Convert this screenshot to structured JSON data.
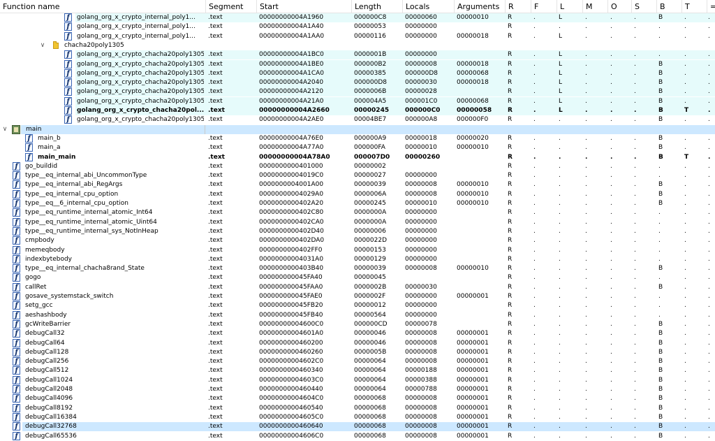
{
  "columns": [
    "Function name",
    "Segment",
    "Start",
    "Length",
    "Locals",
    "Arguments",
    "R",
    "F",
    "L",
    "M",
    "O",
    "S",
    "B",
    "T",
    "="
  ],
  "rows": [
    {
      "kind": "func",
      "level": 3,
      "hl": "cyan",
      "name": "golang_org_x_crypto_internal_poly1...",
      "seg": ".text",
      "start": "00000000004A1960",
      "len": "000000C8",
      "loc": "00000060",
      "args": "00000010",
      "R": "R",
      "F": ".",
      "L": "L",
      "M": ".",
      "O": ".",
      "S": ".",
      "B": "B",
      "T": ".",
      "E": "."
    },
    {
      "kind": "func",
      "level": 3,
      "name": "golang_org_x_crypto_internal_poly1...",
      "seg": ".text",
      "start": "00000000004A1A40",
      "len": "00000053",
      "loc": "00000000",
      "args": "",
      "R": "R",
      "F": ".",
      "L": ".",
      "M": ".",
      "O": ".",
      "S": ".",
      "B": ".",
      "T": ".",
      "E": "."
    },
    {
      "kind": "func",
      "level": 3,
      "name": "golang_org_x_crypto_internal_poly1...",
      "seg": ".text",
      "start": "00000000004A1AA0",
      "len": "00000116",
      "loc": "00000000",
      "args": "00000018",
      "R": "R",
      "F": ".",
      "L": "L",
      "M": ".",
      "O": ".",
      "S": ".",
      "B": ".",
      "T": ".",
      "E": "."
    },
    {
      "kind": "folder",
      "level": 2,
      "name": "chacha20poly1305"
    },
    {
      "kind": "func",
      "level": 3,
      "hl": "cyan",
      "name": "golang_org_x_crypto_chacha20poly1305...",
      "seg": ".text",
      "start": "00000000004A1BC0",
      "len": "0000001B",
      "loc": "00000000",
      "args": "",
      "R": "R",
      "F": ".",
      "L": "L",
      "M": ".",
      "O": ".",
      "S": ".",
      "B": ".",
      "T": ".",
      "E": "."
    },
    {
      "kind": "func",
      "level": 3,
      "hl": "cyan",
      "name": "golang_org_x_crypto_chacha20poly1305...",
      "seg": ".text",
      "start": "00000000004A1BE0",
      "len": "000000B2",
      "loc": "00000008",
      "args": "00000018",
      "R": "R",
      "F": ".",
      "L": "L",
      "M": ".",
      "O": ".",
      "S": ".",
      "B": "B",
      "T": ".",
      "E": "."
    },
    {
      "kind": "func",
      "level": 3,
      "hl": "cyan",
      "name": "golang_org_x_crypto_chacha20poly1305...",
      "seg": ".text",
      "start": "00000000004A1CA0",
      "len": "00000385",
      "loc": "000000D8",
      "args": "00000068",
      "R": "R",
      "F": ".",
      "L": "L",
      "M": ".",
      "O": ".",
      "S": ".",
      "B": "B",
      "T": ".",
      "E": "."
    },
    {
      "kind": "func",
      "level": 3,
      "hl": "cyan",
      "name": "golang_org_x_crypto_chacha20poly1305...",
      "seg": ".text",
      "start": "00000000004A2040",
      "len": "000000D8",
      "loc": "00000030",
      "args": "00000018",
      "R": "R",
      "F": ".",
      "L": "L",
      "M": ".",
      "O": ".",
      "S": ".",
      "B": "B",
      "T": ".",
      "E": "."
    },
    {
      "kind": "func",
      "level": 3,
      "hl": "cyan",
      "name": "golang_org_x_crypto_chacha20poly1305...",
      "seg": ".text",
      "start": "00000000004A2120",
      "len": "0000006B",
      "loc": "00000028",
      "args": "",
      "R": "R",
      "F": ".",
      "L": "L",
      "M": ".",
      "O": ".",
      "S": ".",
      "B": "B",
      "T": ".",
      "E": "."
    },
    {
      "kind": "func",
      "level": 3,
      "hl": "cyan",
      "name": "golang_org_x_crypto_chacha20poly1305...",
      "seg": ".text",
      "start": "00000000004A21A0",
      "len": "000004A5",
      "loc": "000001C0",
      "args": "00000068",
      "R": "R",
      "F": ".",
      "L": "L",
      "M": ".",
      "O": ".",
      "S": ".",
      "B": "B",
      "T": ".",
      "E": "."
    },
    {
      "kind": "func",
      "level": 3,
      "hl": "cyan",
      "bold": true,
      "name": "golang_org_x_crypto_chacha20pol...",
      "seg": ".text",
      "start": "00000000004A2660",
      "len": "00000245",
      "loc": "000000C0",
      "args": "00000058",
      "R": "R",
      "F": ".",
      "L": "L",
      "M": ".",
      "O": ".",
      "S": ".",
      "B": "B",
      "T": "T",
      "E": "."
    },
    {
      "kind": "func",
      "level": 3,
      "name": "golang_org_x_crypto_chacha20poly1305...",
      "seg": ".text",
      "start": "00000000004A2AE0",
      "len": "00004BE7",
      "loc": "000000A8",
      "args": "000000F0",
      "R": "R",
      "F": ".",
      "L": ".",
      "M": ".",
      "O": ".",
      "S": ".",
      "B": "B",
      "T": ".",
      "E": "."
    },
    {
      "kind": "module",
      "level": 0,
      "hl": "blue",
      "name": "main"
    },
    {
      "kind": "func",
      "level": 1,
      "name": "main_b",
      "seg": ".text",
      "start": "00000000004A76E0",
      "len": "000000A9",
      "loc": "00000018",
      "args": "00000020",
      "R": "R",
      "F": ".",
      "L": ".",
      "M": ".",
      "O": ".",
      "S": ".",
      "B": "B",
      "T": ".",
      "E": "."
    },
    {
      "kind": "func",
      "level": 1,
      "name": "main_a",
      "seg": ".text",
      "start": "00000000004A77A0",
      "len": "000000FA",
      "loc": "00000010",
      "args": "00000010",
      "R": "R",
      "F": ".",
      "L": ".",
      "M": ".",
      "O": ".",
      "S": ".",
      "B": "B",
      "T": ".",
      "E": "."
    },
    {
      "kind": "func",
      "level": 1,
      "bold": true,
      "name": "main_main",
      "seg": ".text",
      "start": "00000000004A78A0",
      "len": "000007D0",
      "loc": "00000260",
      "args": "",
      "R": "R",
      "F": ".",
      "L": ".",
      "M": ".",
      "O": ".",
      "S": ".",
      "B": "B",
      "T": "T",
      "E": "."
    },
    {
      "kind": "func",
      "level": 0,
      "name": "go_buildid",
      "seg": ".text",
      "start": "0000000000401000",
      "len": "00000002",
      "loc": "",
      "args": "",
      "R": "R",
      "F": ".",
      "L": ".",
      "M": ".",
      "O": ".",
      "S": ".",
      "B": ".",
      "T": ".",
      "E": "."
    },
    {
      "kind": "func",
      "level": 0,
      "name": "type__eq_internal_abi_UncommonType",
      "seg": ".text",
      "start": "00000000004019C0",
      "len": "00000027",
      "loc": "00000000",
      "args": "",
      "R": "R",
      "F": ".",
      "L": ".",
      "M": ".",
      "O": ".",
      "S": ".",
      "B": ".",
      "T": ".",
      "E": "."
    },
    {
      "kind": "func",
      "level": 0,
      "name": "type__eq_internal_abi_RegArgs",
      "seg": ".text",
      "start": "0000000004001A00",
      "len": "00000039",
      "loc": "00000008",
      "args": "00000010",
      "R": "R",
      "F": ".",
      "L": ".",
      "M": ".",
      "O": ".",
      "S": ".",
      "B": "B",
      "T": ".",
      "E": "."
    },
    {
      "kind": "func",
      "level": 0,
      "name": "type__eq_internal_cpu_option",
      "seg": ".text",
      "start": "00000000004029A0",
      "len": "0000006A",
      "loc": "00000008",
      "args": "00000010",
      "R": "R",
      "F": ".",
      "L": ".",
      "M": ".",
      "O": ".",
      "S": ".",
      "B": "B",
      "T": ".",
      "E": "."
    },
    {
      "kind": "func",
      "level": 0,
      "name": "type__eq__6_internal_cpu_option",
      "seg": ".text",
      "start": "0000000000402A20",
      "len": "00000245",
      "loc": "00000010",
      "args": "00000010",
      "R": "R",
      "F": ".",
      "L": ".",
      "M": ".",
      "O": ".",
      "S": ".",
      "B": "B",
      "T": ".",
      "E": "."
    },
    {
      "kind": "func",
      "level": 0,
      "name": "type__eq_runtime_internal_atomic_Int64",
      "seg": ".text",
      "start": "0000000000402C80",
      "len": "0000000A",
      "loc": "00000000",
      "args": "",
      "R": "R",
      "F": ".",
      "L": ".",
      "M": ".",
      "O": ".",
      "S": ".",
      "B": ".",
      "T": ".",
      "E": "."
    },
    {
      "kind": "func",
      "level": 0,
      "name": "type__eq_runtime_internal_atomic_Uint64",
      "seg": ".text",
      "start": "0000000000402CA0",
      "len": "0000000A",
      "loc": "00000000",
      "args": "",
      "R": "R",
      "F": ".",
      "L": ".",
      "M": ".",
      "O": ".",
      "S": ".",
      "B": ".",
      "T": ".",
      "E": "."
    },
    {
      "kind": "func",
      "level": 0,
      "name": "type__eq_runtime_internal_sys_NotInHeap",
      "seg": ".text",
      "start": "0000000000402D40",
      "len": "00000006",
      "loc": "00000000",
      "args": "",
      "R": "R",
      "F": ".",
      "L": ".",
      "M": ".",
      "O": ".",
      "S": ".",
      "B": ".",
      "T": ".",
      "E": "."
    },
    {
      "kind": "func",
      "level": 0,
      "name": "cmpbody",
      "seg": ".text",
      "start": "0000000000402DA0",
      "len": "0000022D",
      "loc": "00000000",
      "args": "",
      "R": "R",
      "F": ".",
      "L": ".",
      "M": ".",
      "O": ".",
      "S": ".",
      "B": ".",
      "T": ".",
      "E": "."
    },
    {
      "kind": "func",
      "level": 0,
      "name": "memeqbody",
      "seg": ".text",
      "start": "0000000000402FF0",
      "len": "00000153",
      "loc": "00000000",
      "args": "",
      "R": "R",
      "F": ".",
      "L": ".",
      "M": ".",
      "O": ".",
      "S": ".",
      "B": ".",
      "T": ".",
      "E": "."
    },
    {
      "kind": "func",
      "level": 0,
      "name": "indexbytebody",
      "seg": ".text",
      "start": "00000000004031A0",
      "len": "00000129",
      "loc": "00000000",
      "args": "",
      "R": "R",
      "F": ".",
      "L": ".",
      "M": ".",
      "O": ".",
      "S": ".",
      "B": ".",
      "T": ".",
      "E": "."
    },
    {
      "kind": "func",
      "level": 0,
      "name": "type__eq_internal_chacha8rand_State",
      "seg": ".text",
      "start": "0000000000403B40",
      "len": "00000039",
      "loc": "00000008",
      "args": "00000010",
      "R": "R",
      "F": ".",
      "L": ".",
      "M": ".",
      "O": ".",
      "S": ".",
      "B": "B",
      "T": ".",
      "E": "."
    },
    {
      "kind": "func",
      "level": 0,
      "name": "gogo",
      "seg": ".text",
      "start": "000000000045FA40",
      "len": "00000045",
      "loc": "",
      "args": "",
      "R": "R",
      "F": ".",
      "L": ".",
      "M": ".",
      "O": ".",
      "S": ".",
      "B": ".",
      "T": ".",
      "E": "."
    },
    {
      "kind": "func",
      "level": 0,
      "name": "callRet",
      "seg": ".text",
      "start": "000000000045FAA0",
      "len": "0000002B",
      "loc": "00000030",
      "args": "",
      "R": "R",
      "F": ".",
      "L": ".",
      "M": ".",
      "O": ".",
      "S": ".",
      "B": "B",
      "T": ".",
      "E": "."
    },
    {
      "kind": "func",
      "level": 0,
      "name": "gosave_systemstack_switch",
      "seg": ".text",
      "start": "000000000045FAE0",
      "len": "0000002F",
      "loc": "00000000",
      "args": "00000001",
      "R": "R",
      "F": ".",
      "L": ".",
      "M": ".",
      "O": ".",
      "S": ".",
      "B": ".",
      "T": ".",
      "E": "."
    },
    {
      "kind": "func",
      "level": 0,
      "name": "setg_gcc",
      "seg": ".text",
      "start": "000000000045FB20",
      "len": "00000012",
      "loc": "00000000",
      "args": "",
      "R": "R",
      "F": ".",
      "L": ".",
      "M": ".",
      "O": ".",
      "S": ".",
      "B": ".",
      "T": ".",
      "E": "."
    },
    {
      "kind": "func",
      "level": 0,
      "name": "aeshashbody",
      "seg": ".text",
      "start": "000000000045FB40",
      "len": "00000564",
      "loc": "00000000",
      "args": "",
      "R": "R",
      "F": ".",
      "L": ".",
      "M": ".",
      "O": ".",
      "S": ".",
      "B": ".",
      "T": ".",
      "E": "."
    },
    {
      "kind": "func",
      "level": 0,
      "name": "gcWriteBarrier",
      "seg": ".text",
      "start": "00000000004600C0",
      "len": "000000CD",
      "loc": "00000078",
      "args": "",
      "R": "R",
      "F": ".",
      "L": ".",
      "M": ".",
      "O": ".",
      "S": ".",
      "B": "B",
      "T": ".",
      "E": "."
    },
    {
      "kind": "func",
      "level": 0,
      "name": "debugCall32",
      "seg": ".text",
      "start": "00000000004601A0",
      "len": "00000046",
      "loc": "00000008",
      "args": "00000001",
      "R": "R",
      "F": ".",
      "L": ".",
      "M": ".",
      "O": ".",
      "S": ".",
      "B": "B",
      "T": ".",
      "E": "."
    },
    {
      "kind": "func",
      "level": 0,
      "name": "debugCall64",
      "seg": ".text",
      "start": "0000000000460200",
      "len": "00000046",
      "loc": "00000008",
      "args": "00000001",
      "R": "R",
      "F": ".",
      "L": ".",
      "M": ".",
      "O": ".",
      "S": ".",
      "B": "B",
      "T": ".",
      "E": "."
    },
    {
      "kind": "func",
      "level": 0,
      "name": "debugCall128",
      "seg": ".text",
      "start": "0000000000460260",
      "len": "0000005B",
      "loc": "00000008",
      "args": "00000001",
      "R": "R",
      "F": ".",
      "L": ".",
      "M": ".",
      "O": ".",
      "S": ".",
      "B": "B",
      "T": ".",
      "E": "."
    },
    {
      "kind": "func",
      "level": 0,
      "name": "debugCall256",
      "seg": ".text",
      "start": "00000000004602C0",
      "len": "00000064",
      "loc": "00000008",
      "args": "00000001",
      "R": "R",
      "F": ".",
      "L": ".",
      "M": ".",
      "O": ".",
      "S": ".",
      "B": "B",
      "T": ".",
      "E": "."
    },
    {
      "kind": "func",
      "level": 0,
      "name": "debugCall512",
      "seg": ".text",
      "start": "0000000000460340",
      "len": "00000064",
      "loc": "00000188",
      "args": "00000001",
      "R": "R",
      "F": ".",
      "L": ".",
      "M": ".",
      "O": ".",
      "S": ".",
      "B": "B",
      "T": ".",
      "E": "."
    },
    {
      "kind": "func",
      "level": 0,
      "name": "debugCall1024",
      "seg": ".text",
      "start": "00000000004603C0",
      "len": "00000064",
      "loc": "00000388",
      "args": "00000001",
      "R": "R",
      "F": ".",
      "L": ".",
      "M": ".",
      "O": ".",
      "S": ".",
      "B": "B",
      "T": ".",
      "E": "."
    },
    {
      "kind": "func",
      "level": 0,
      "name": "debugCall2048",
      "seg": ".text",
      "start": "0000000000460440",
      "len": "00000064",
      "loc": "00000788",
      "args": "00000001",
      "R": "R",
      "F": ".",
      "L": ".",
      "M": ".",
      "O": ".",
      "S": ".",
      "B": "B",
      "T": ".",
      "E": "."
    },
    {
      "kind": "func",
      "level": 0,
      "name": "debugCall4096",
      "seg": ".text",
      "start": "00000000004604C0",
      "len": "00000068",
      "loc": "00000008",
      "args": "00000001",
      "R": "R",
      "F": ".",
      "L": ".",
      "M": ".",
      "O": ".",
      "S": ".",
      "B": "B",
      "T": ".",
      "E": "."
    },
    {
      "kind": "func",
      "level": 0,
      "name": "debugCall8192",
      "seg": ".text",
      "start": "0000000000460540",
      "len": "00000068",
      "loc": "00000008",
      "args": "00000001",
      "R": "R",
      "F": ".",
      "L": ".",
      "M": ".",
      "O": ".",
      "S": ".",
      "B": "B",
      "T": ".",
      "E": "."
    },
    {
      "kind": "func",
      "level": 0,
      "name": "debugCall16384",
      "seg": ".text",
      "start": "00000000004605C0",
      "len": "00000068",
      "loc": "00000008",
      "args": "00000001",
      "R": "R",
      "F": ".",
      "L": ".",
      "M": ".",
      "O": ".",
      "S": ".",
      "B": "B",
      "T": ".",
      "E": "."
    },
    {
      "kind": "func",
      "level": 0,
      "hl": "blue",
      "name": "debugCall32768",
      "seg": ".text",
      "start": "0000000000460640",
      "len": "00000068",
      "loc": "00000008",
      "args": "00000001",
      "R": "R",
      "F": ".",
      "L": ".",
      "M": ".",
      "O": ".",
      "S": ".",
      "B": "B",
      "T": ".",
      "E": "."
    },
    {
      "kind": "func",
      "level": 0,
      "name": "debugCall65536",
      "seg": ".text",
      "start": "00000000004606C0",
      "len": "00000068",
      "loc": "00000008",
      "args": "00000001",
      "R": "R",
      "F": ".",
      "L": ".",
      "M": ".",
      "O": ".",
      "S": ".",
      "B": "B",
      "T": ".",
      "E": "."
    }
  ],
  "icons": {
    "func": "function-icon",
    "folder": "folder-icon",
    "module": "module-icon",
    "expand": "chevron-down-icon"
  },
  "colors": {
    "row_highlight_cyan": "#e6fbfb",
    "row_highlight_blue": "#cde8ff",
    "func_icon_border": "#3a66b5",
    "folder": "#f0c431"
  }
}
